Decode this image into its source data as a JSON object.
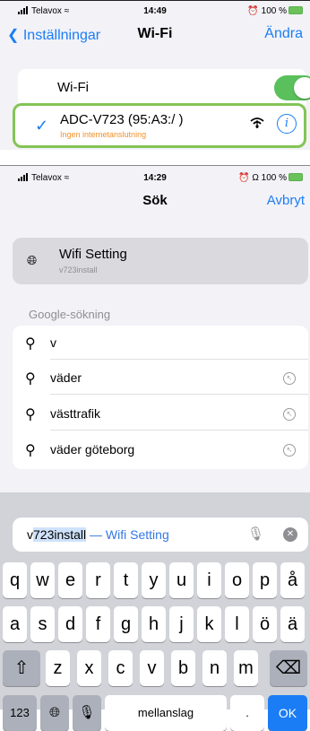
{
  "shot1": {
    "status": {
      "carrier": "Telavox",
      "time": "14:49",
      "battery": "100 %"
    },
    "nav": {
      "back_label": "Inställningar",
      "title": "Wi-Fi",
      "edit_label": "Ändra"
    },
    "wifi_row": {
      "label": "Wi-Fi",
      "enabled": true
    },
    "network": {
      "name": "ADC-V723 (95:A3:/  )",
      "status": "Ingen internetanslutning",
      "info_glyph": "i"
    }
  },
  "shot2": {
    "status": {
      "carrier": "Telavox",
      "time": "14:29",
      "battery": "100 %"
    },
    "nav": {
      "title": "Sök",
      "cancel_label": "Avbryt"
    },
    "top_hit": {
      "title": "Wifi Setting",
      "subtitle": "v723install"
    },
    "section_label": "Google-sökning",
    "results": [
      "v",
      "väder",
      "västtrafik",
      "väder göteborg"
    ],
    "search": {
      "typed": "v",
      "selected": "723install",
      "hint": " — Wifi Setting"
    },
    "keyboard": {
      "row1": [
        "q",
        "w",
        "e",
        "r",
        "t",
        "y",
        "u",
        "i",
        "o",
        "p",
        "å"
      ],
      "row2": [
        "a",
        "s",
        "d",
        "f",
        "g",
        "h",
        "j",
        "k",
        "l",
        "ö",
        "ä"
      ],
      "row3": [
        "z",
        "x",
        "c",
        "v",
        "b",
        "n",
        "m"
      ],
      "numbers_label": "123",
      "space_label": "mellanslag",
      "dot_label": ".",
      "ok_label": "OK"
    }
  },
  "colors": {
    "accent": "#1b7df5",
    "toggle_on": "#5ac05b",
    "highlight_border": "#84c456",
    "warning_text": "#f0902a"
  }
}
